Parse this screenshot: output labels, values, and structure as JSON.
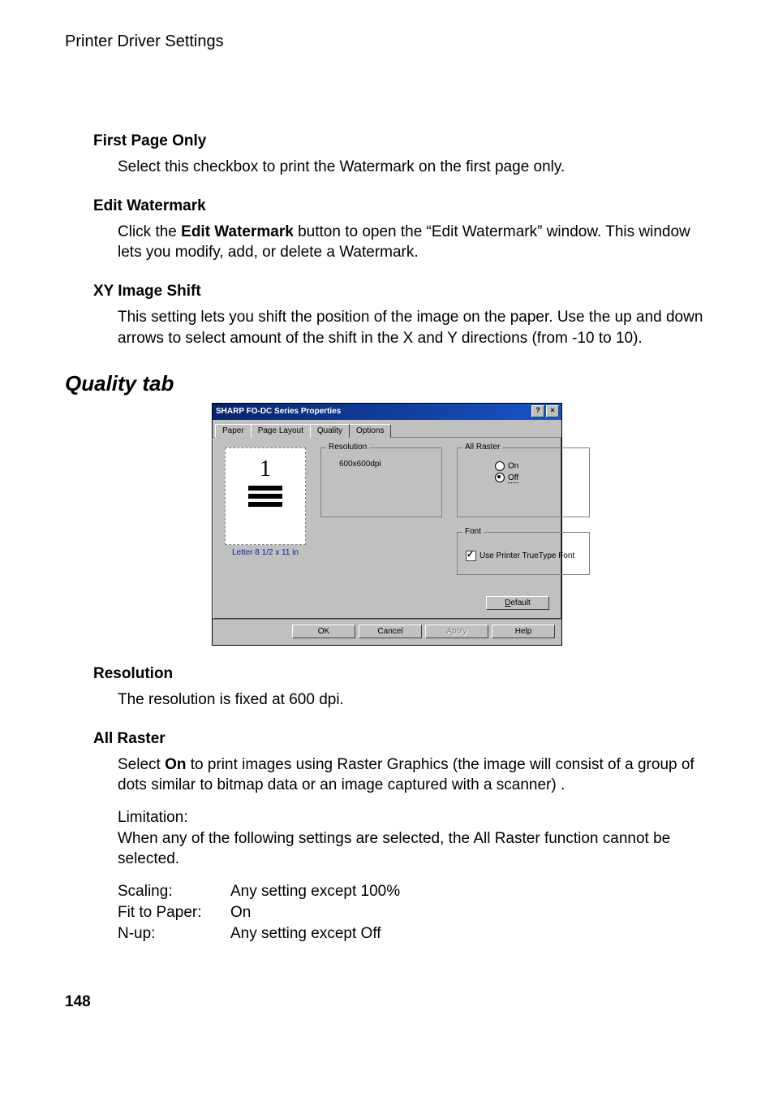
{
  "running_head": "Printer Driver Settings",
  "sec1": {
    "h": "First Page Only",
    "p": "Select this checkbox to print the Watermark on the first page only."
  },
  "sec2": {
    "h": "Edit Watermark",
    "p_pre": "Click the ",
    "p_bold": "Edit Watermark",
    "p_post": " button to open the “Edit Watermark” window.  This window lets you modify, add, or delete a Watermark."
  },
  "sec3": {
    "h": "XY Image Shift",
    "p": "This setting lets you shift the position of the image on the paper. Use the up and down arrows to select amount of the shift in the X and Y directions (from -10 to 10)."
  },
  "quality_heading": "Quality tab",
  "dialog": {
    "title": "SHARP FO-DC Series  Properties",
    "help_btn": "?",
    "close_btn": "×",
    "tabs": {
      "paper": "Paper",
      "pagelayout": "Page Layout",
      "quality": "Quality",
      "options": "Options"
    },
    "preview_num": "1",
    "preview_caption": "Letter 8 1/2 x 11 in",
    "group_resolution": "Resolution",
    "resolution_value": "600x600dpi",
    "group_allraster": "All Raster",
    "ar_on": "On",
    "ar_off": "Off",
    "group_font": "Font",
    "font_chk": "Use Printer TrueType Font",
    "btn_default": "Default",
    "btn_ok": "OK",
    "btn_cancel": "Cancel",
    "btn_apply": "Apply",
    "btn_help": "Help"
  },
  "sec4": {
    "h": "Resolution",
    "p": "The resolution is fixed at 600 dpi."
  },
  "sec5": {
    "h": "All Raster",
    "p_pre": "Select ",
    "p_bold": "On",
    "p_post": " to print images using Raster Graphics (the image will consist of a group of dots similar to bitmap data or an image captured with a scanner) .",
    "lim_label": "Limitation:",
    "lim_text": "When any of the following settings are selected, the All Raster function cannot be selected.",
    "rows": {
      "scaling": {
        "l": "Scaling:",
        "v": "Any setting except 100%"
      },
      "fit": {
        "l": "Fit to Paper:",
        "v": "On"
      },
      "nup": {
        "l": "N-up:",
        "v": "Any setting except Off"
      }
    }
  },
  "page_number": "148"
}
